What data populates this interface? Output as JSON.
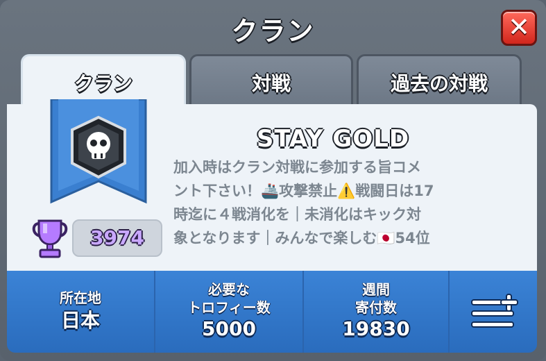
{
  "header": {
    "title": "クラン"
  },
  "tabs": [
    {
      "label": "クラン"
    },
    {
      "label": "対戦"
    },
    {
      "label": "過去の対戦"
    }
  ],
  "clan": {
    "name": "STAY GOLD",
    "trophies": "3974",
    "description_lines": [
      "加入時はクラン対戦に参加する旨コメ",
      "ント下さい！🚢攻撃禁止⚠️戦闘日は17",
      "時迄に４戦消化を｜未消化はキック対",
      "象となります｜みんなで楽しむ🇯🇵54位"
    ]
  },
  "stats": {
    "location": {
      "label": "所在地",
      "value": "日本"
    },
    "required_trophies": {
      "label_line1": "必要な",
      "label_line2": "トロフィー数",
      "value": "5000"
    },
    "weekly_donations": {
      "label_line1": "週間",
      "label_line2": "寄付数",
      "value": "19830"
    }
  },
  "icons": {
    "close": "close-icon",
    "badge": "skull-badge-icon",
    "trophy": "trophy-icon",
    "menu": "list-add-icon"
  },
  "colors": {
    "stats_bar": "#2f73c8",
    "banner": "#3a7fd0",
    "close_button": "#e0372b",
    "trophy": "#b57bff"
  }
}
